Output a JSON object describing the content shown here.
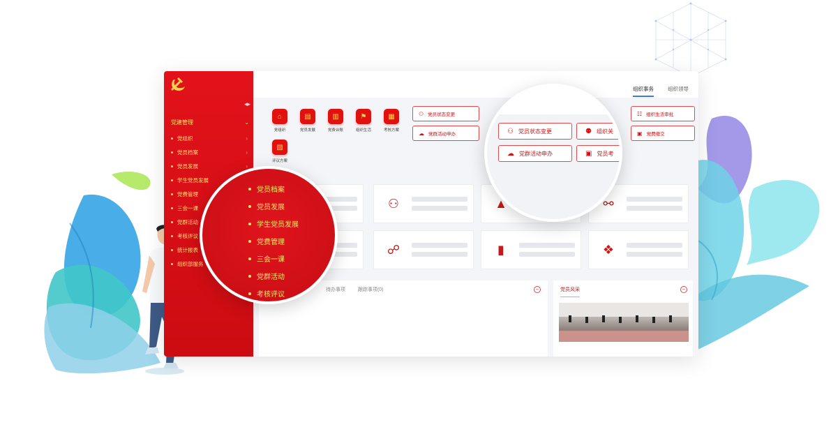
{
  "sidebar": {
    "menu_head": "党建管理",
    "items": [
      {
        "label": "党组织"
      },
      {
        "label": "党员档案"
      },
      {
        "label": "党员发展"
      },
      {
        "label": "学生党员发展"
      },
      {
        "label": "党费管理"
      },
      {
        "label": "三会一课"
      },
      {
        "label": "党群活动"
      },
      {
        "label": "考核评议"
      },
      {
        "label": "统计报表"
      },
      {
        "label": "组织部服务"
      }
    ]
  },
  "topbar": {
    "tabs": [
      {
        "label": "组织事务"
      },
      {
        "label": "组织领导"
      }
    ]
  },
  "shortcuts": [
    {
      "label": "党组织"
    },
    {
      "label": "党员发展"
    },
    {
      "label": "党费台账"
    },
    {
      "label": "组织生活"
    },
    {
      "label": "考核方案"
    },
    {
      "label": "评议方案"
    }
  ],
  "quick_buttons": [
    {
      "label": "党员状态变更"
    },
    {
      "label": "组织生活审批"
    },
    {
      "label": "党群活动申办"
    },
    {
      "label": "党费缴交"
    }
  ],
  "todo": {
    "tabs": [
      {
        "label": "待办事项"
      },
      {
        "label": "跟踪事项(0)"
      }
    ]
  },
  "news": {
    "title": "党员风采"
  },
  "lens_left": {
    "items": [
      {
        "label": "党员档案"
      },
      {
        "label": "党员发展"
      },
      {
        "label": "学生党员发展"
      },
      {
        "label": "党费管理"
      },
      {
        "label": "三会一课"
      },
      {
        "label": "党群活动"
      },
      {
        "label": "考核评议"
      }
    ]
  },
  "lens_right": {
    "buttons": [
      {
        "label": "党员状态变更"
      },
      {
        "label": "组织关"
      },
      {
        "label": "党群活动申办"
      },
      {
        "label": "党员考"
      }
    ]
  }
}
